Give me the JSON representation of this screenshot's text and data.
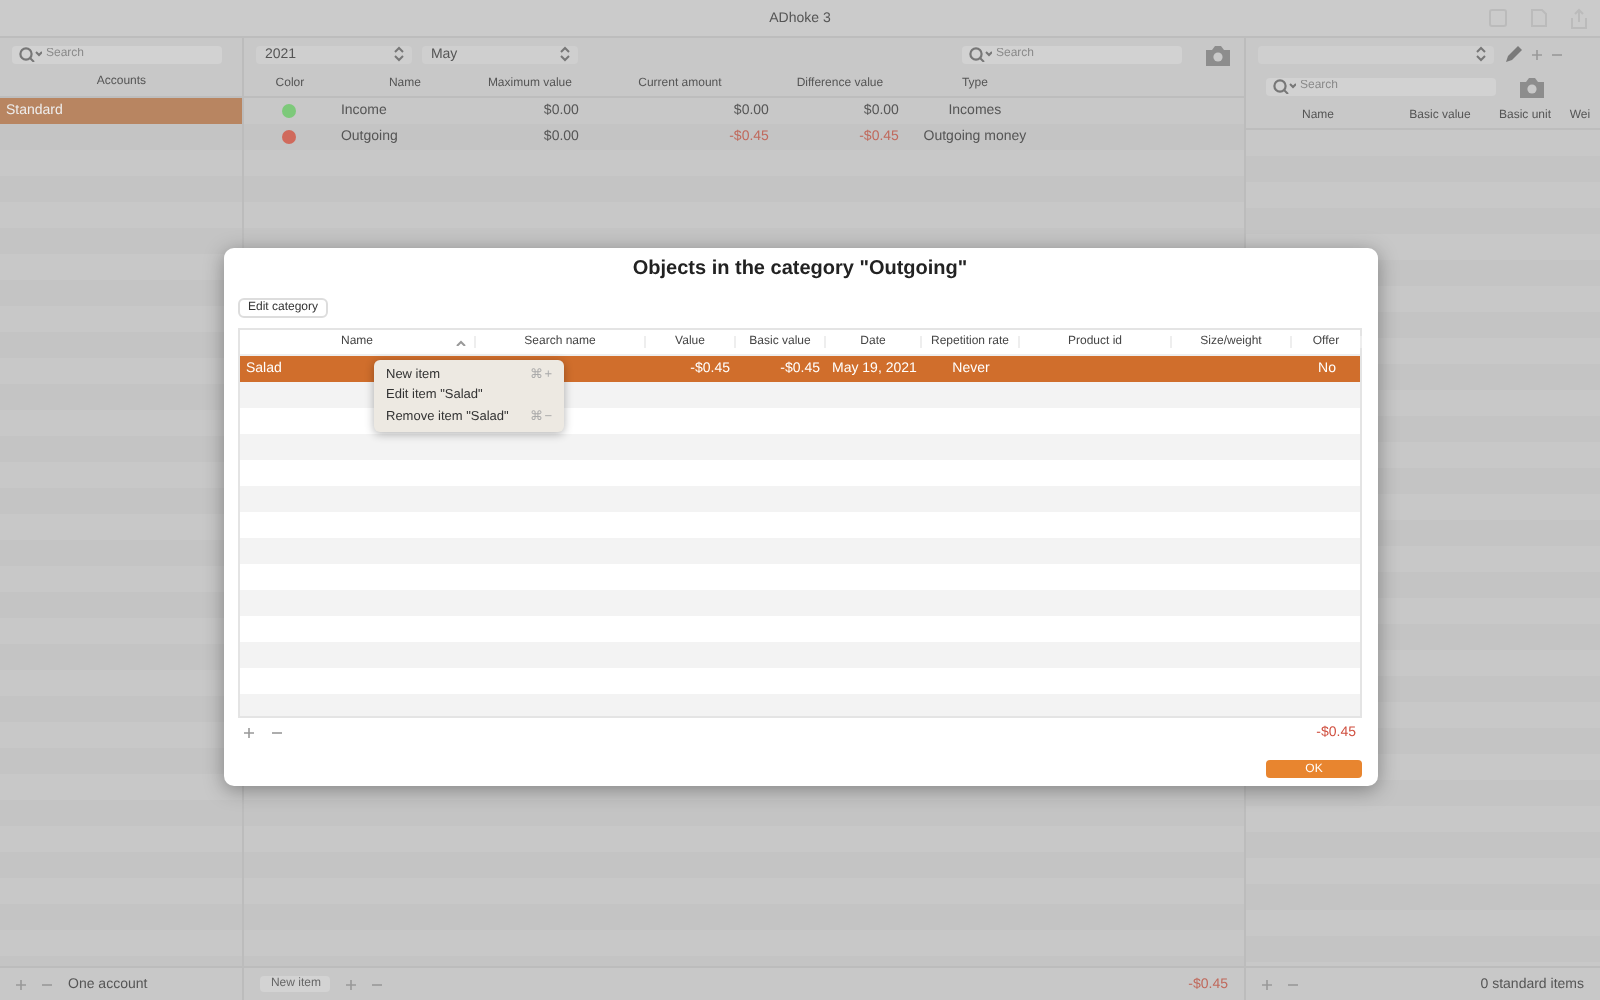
{
  "window": {
    "title": "ADhoke 3"
  },
  "sidebar": {
    "search": {
      "placeholder": "Search"
    },
    "column": "Accounts",
    "items": [
      {
        "label": "Standard",
        "selected": true
      }
    ],
    "footer": "One account"
  },
  "main": {
    "year": "2021",
    "month": "May",
    "search": {
      "placeholder": "Search"
    },
    "columns": [
      "Color",
      "Name",
      "Maximum value",
      "Current amount",
      "Difference value",
      "Type"
    ],
    "rows": [
      {
        "color": "#7dc97a",
        "name": "Income",
        "maximum": "$0.00",
        "current": "$0.00",
        "difference": "$0.00",
        "type": "Incomes",
        "negative": false
      },
      {
        "color": "#d06a5c",
        "name": "Outgoing",
        "maximum": "$0.00",
        "current": "-$0.45",
        "difference": "-$0.45",
        "type": "Outgoing money",
        "negative": true
      }
    ],
    "footer": {
      "button": "New item",
      "total": "-$0.45"
    }
  },
  "right_panel": {
    "search": {
      "placeholder": "Search"
    },
    "columns": [
      "Name",
      "Basic value",
      "Basic unit",
      "Wei"
    ],
    "footer": "0 standard items"
  },
  "dialog": {
    "title": "Objects in the category \"Outgoing\"",
    "edit_button": "Edit category",
    "columns": [
      {
        "label": "Name",
        "sorted": true
      },
      {
        "label": "Search name",
        "sorted": false
      },
      {
        "label": "Value",
        "sorted": false
      },
      {
        "label": "Basic value",
        "sorted": false
      },
      {
        "label": "Date",
        "sorted": false
      },
      {
        "label": "Repetition rate",
        "sorted": false
      },
      {
        "label": "Product id",
        "sorted": false
      },
      {
        "label": "Size/weight",
        "sorted": false
      },
      {
        "label": "Offer",
        "sorted": false
      }
    ],
    "rows": [
      {
        "cells": [
          "Salad",
          "",
          "-$0.45",
          "-$0.45",
          "May 19, 2021",
          "Never",
          "",
          "",
          "No"
        ],
        "selected": true
      }
    ],
    "total": "-$0.45",
    "ok": "OK"
  },
  "context_menu": {
    "items": [
      {
        "label": "New item",
        "shortcut": "⌘+"
      },
      {
        "label": "Edit item \"Salad\""
      },
      {
        "label": "Remove item \"Salad\"",
        "shortcut": "⌘−"
      }
    ]
  }
}
